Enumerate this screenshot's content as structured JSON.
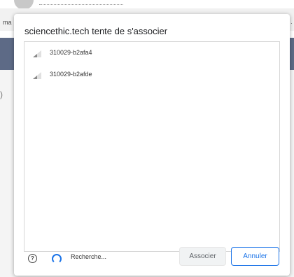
{
  "background": {
    "partial_text": "ma"
  },
  "dialog": {
    "title": "sciencethic.tech tente de s'associer",
    "devices": [
      {
        "name": "310029-b2afa4",
        "icon": "signal-strength-icon"
      },
      {
        "name": "310029-b2afde",
        "icon": "signal-strength-icon"
      }
    ],
    "help_icon": "help-icon",
    "help_glyph": "?",
    "spinner_icon": "loading-spinner-icon",
    "status_text": "Recherche...",
    "associate_label": "Associer",
    "cancel_label": "Annuler",
    "accent_color": "#1a73e8"
  }
}
